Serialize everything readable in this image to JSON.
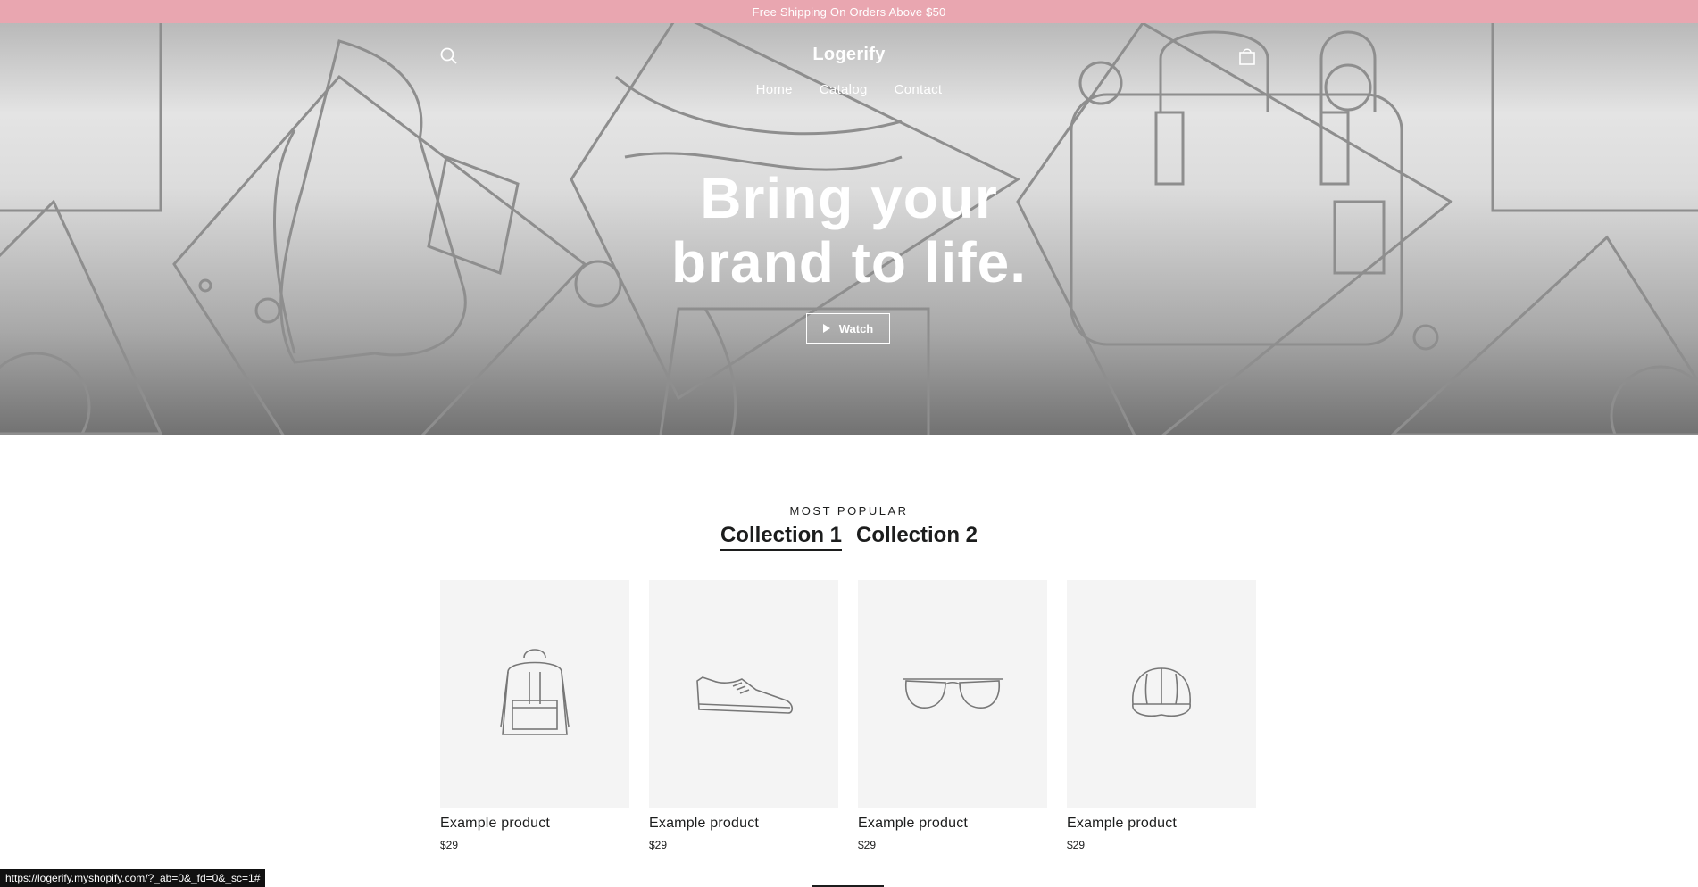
{
  "announcement": "Free Shipping On Orders Above $50",
  "header": {
    "logo": "Logerify",
    "search_icon": "search-icon",
    "cart_icon": "cart-icon",
    "nav": [
      "Home",
      "Catalog",
      "Contact"
    ]
  },
  "hero": {
    "title_line1": "Bring your",
    "title_line2": "brand to life.",
    "watch_label": "Watch",
    "watch_icon": "play-icon"
  },
  "collections": {
    "subtitle": "MOST POPULAR",
    "tabs": [
      "Collection 1",
      "Collection 2"
    ],
    "active_tab": "Collection 1",
    "products": [
      {
        "title": "Example product",
        "price": "$29",
        "image_icon": "backpack-icon"
      },
      {
        "title": "Example product",
        "price": "$29",
        "image_icon": "sneaker-icon"
      },
      {
        "title": "Example product",
        "price": "$29",
        "image_icon": "sunglasses-icon"
      },
      {
        "title": "Example product",
        "price": "$29",
        "image_icon": "cap-icon"
      }
    ]
  },
  "status_bar": {
    "url": "https://logerify.myshopify.com/?_ab=0&_fd=0&_sc=1#"
  },
  "colors": {
    "announcement_bg": "#e9a6b0",
    "text": "#1c1d1d",
    "card_bg": "#f4f4f4"
  }
}
